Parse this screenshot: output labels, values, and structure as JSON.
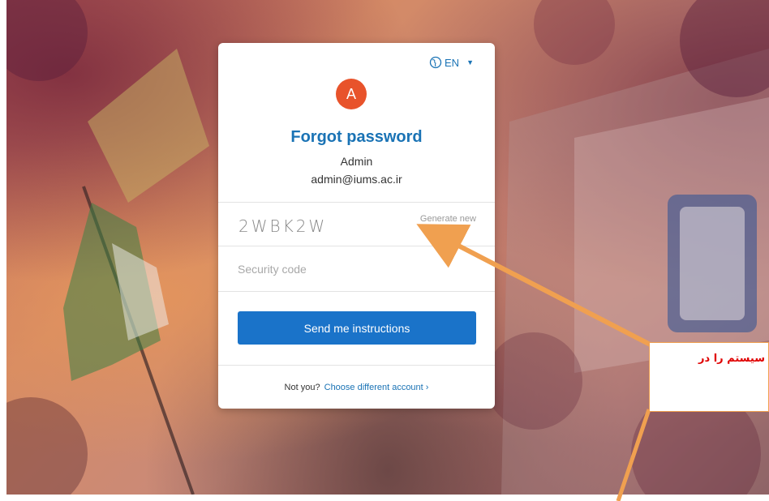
{
  "language": {
    "code": "EN"
  },
  "avatar": {
    "initial": "A"
  },
  "title": "Forgot password",
  "user": {
    "name": "Admin",
    "email": "admin@iums.ac.ir"
  },
  "captcha": {
    "code": "2WBK2W",
    "generate_label": "Generate new"
  },
  "security_code": {
    "placeholder": "Security code",
    "value": ""
  },
  "send_button": {
    "label": "Send me instructions"
  },
  "footer": {
    "question": "Not you?",
    "link_label": "Choose different account ›"
  },
  "annotation": {
    "text": "سیستم را در"
  },
  "colors": {
    "accent": "#1a73c9",
    "avatar": "#e8532b",
    "annotation_text": "#e00000",
    "arrow": "#f0a050"
  }
}
